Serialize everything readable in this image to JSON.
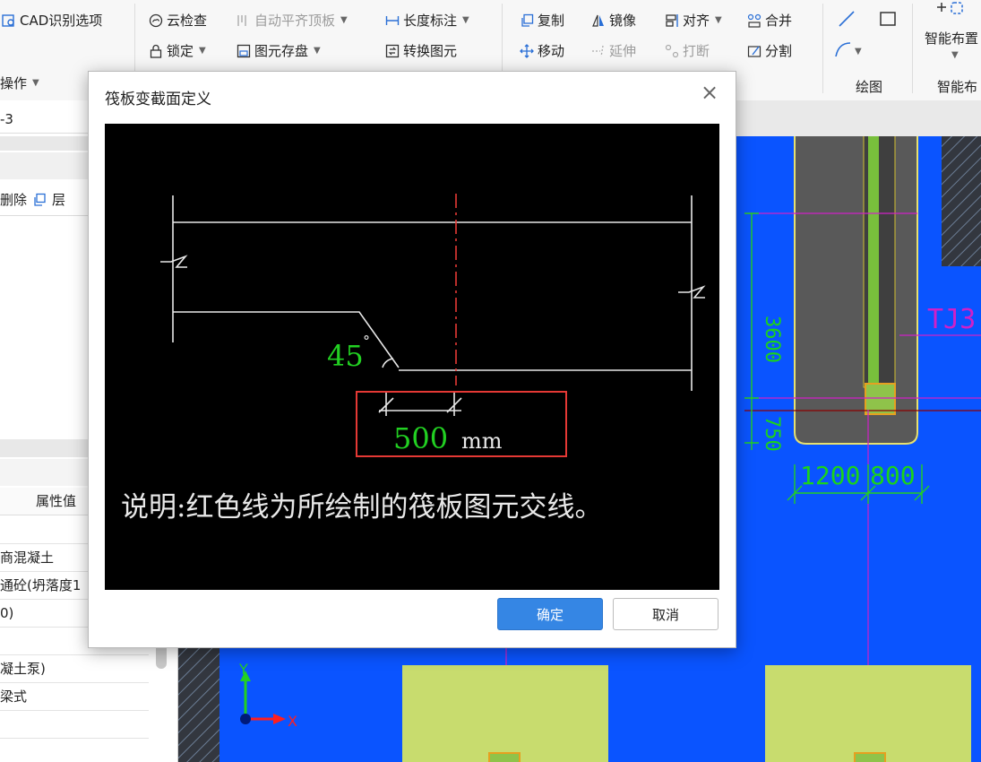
{
  "ribbon": {
    "cad_options": "CAD识别选项",
    "operate": "操作",
    "cloud_check": "云检查",
    "lock": "锁定",
    "auto_align_top": "自动平齐顶板",
    "save_element": "图元存盘",
    "length_dim": "长度标注",
    "convert_element": "转换图元",
    "copy": "复制",
    "move": "移动",
    "mirror": "镜像",
    "extend": "延伸",
    "align": "对齐",
    "break": "打断",
    "merge": "合并",
    "split": "分割",
    "draw_group": "绘图",
    "smart_layout": "智能布置",
    "smart_layout_group": "智能布"
  },
  "left_panel": {
    "field_value": "-3",
    "delete": "删除",
    "layer": "层",
    "prop_header": "属性值",
    "rows": [
      "",
      "商混凝土",
      "通砼(坍落度1",
      "0)",
      "",
      "凝土泵)",
      "梁式",
      ""
    ]
  },
  "dialog": {
    "title": "筏板变截面定义",
    "angle_value": "45",
    "angle_unit": "°",
    "width_value": "500",
    "width_unit": "mm",
    "note": "说明:红色线为所绘制的筏板图元交线。",
    "ok": "确定",
    "cancel": "取消"
  },
  "canvas": {
    "dim_1200": "1200",
    "dim_800": "800",
    "dim_left_top": "3600",
    "dim_left_bottom": "750",
    "tag": "TJ3",
    "axis_y": "Y",
    "axis_x": "X"
  },
  "colors": {
    "canvas_bg": "#0a54ff",
    "ok_button": "#3586e4",
    "dim_green": "#22d022",
    "red_line": "#e53935",
    "magenta": "#d020c8",
    "raft_fill": "#c8dc6e"
  }
}
